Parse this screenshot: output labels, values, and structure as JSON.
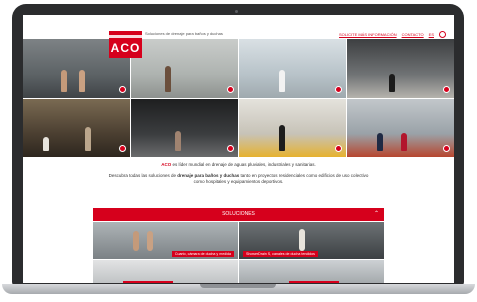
{
  "header": {
    "logo_text": "ACO",
    "tagline": "Soluciones de drenaje para baños y duchas",
    "nav": [
      "SOLICITE MÁS INFORMACIÓN",
      "CONTACTO",
      "ES"
    ]
  },
  "intro": {
    "line1_brand": "ACO",
    "line1_rest": " es líder mundial en drenaje de aguas pluviales, industriales y sanitarias.",
    "line2_pre": "Descubra todas las soluciones de ",
    "line2_bold": "drenaje para baños y duchas",
    "line2_post": " tanto en proyectos residenciales como edificios de uso colectivo",
    "line3": "como hospitales y equipamientos deportivos."
  },
  "solutions": {
    "title": "SOLUCIONES",
    "captions": [
      "Cuarto, cámara de ducha y medida",
      "ShowerDrain S, canales de ducha tendidos"
    ]
  },
  "colors": {
    "brand_red": "#d6001c"
  }
}
